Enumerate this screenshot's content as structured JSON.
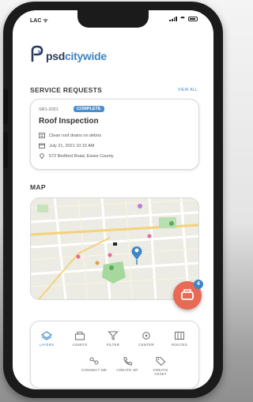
{
  "status_bar": {
    "carrier": "LAC ᯤ"
  },
  "app": {
    "logo_psd": "psd",
    "logo_citywide": "citywide"
  },
  "service_requests": {
    "section_title": "SERVICE REQUESTS",
    "view_all_label": "VIEW ALL",
    "card": {
      "id": "SR1-2021",
      "status_badge": "COMPLETE",
      "title": "Roof Inspection",
      "description": "Clean roof drains on debris",
      "date": "July 21, 2021 10:15 AM",
      "address": "572 Bedford Road, Essex County"
    }
  },
  "map": {
    "section_title": "MAP"
  },
  "fab": {
    "badge_count": "4"
  },
  "toolbar": {
    "row1": [
      {
        "label": "LAYERS",
        "icon": "layers-icon",
        "active": true
      },
      {
        "label": "ASSETS",
        "icon": "assets-icon"
      },
      {
        "label": "FILTER",
        "icon": "filter-icon"
      },
      {
        "label": "CENTER",
        "icon": "center-icon"
      },
      {
        "label": "ROUTES",
        "icon": "routes-icon"
      }
    ],
    "row2": [
      {
        "label": "CONNECT ME",
        "icon": "connect-icon"
      },
      {
        "label": "CREATE SR",
        "icon": "create-sr-icon"
      },
      {
        "label": "CREATE ASSET",
        "icon": "create-asset-icon"
      }
    ]
  },
  "colors": {
    "brand_dark": "#2b3a5c",
    "brand_blue": "#3d86c8",
    "fab_coral": "#e86a55",
    "map_pin": "#3d86c8"
  }
}
